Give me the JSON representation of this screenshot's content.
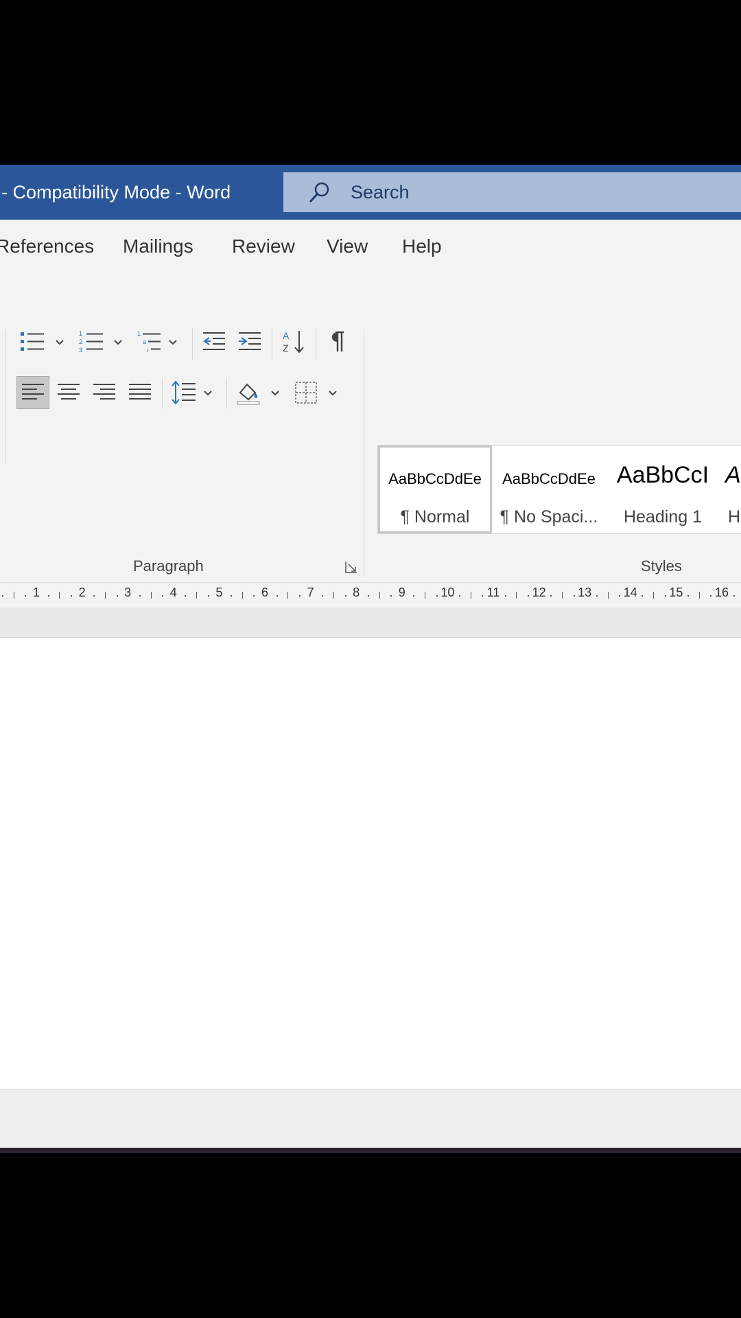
{
  "window": {
    "title": "- Compatibility Mode  -  Word"
  },
  "search": {
    "label": "Search"
  },
  "tabs": [
    {
      "label": "References"
    },
    {
      "label": "Mailings"
    },
    {
      "label": "Review"
    },
    {
      "label": "View"
    },
    {
      "label": "Help"
    }
  ],
  "ribbon": {
    "groups": {
      "paragraph": "Paragraph",
      "styles": "Styles"
    },
    "styles": [
      {
        "preview": "AaBbCcDdEe",
        "name": "¶ Normal"
      },
      {
        "preview": "AaBbCcDdEe",
        "name": "¶ No Spaci..."
      },
      {
        "preview": "AaBbCcI",
        "name": "Heading 1"
      },
      {
        "preview": "A",
        "name": "H"
      }
    ]
  },
  "ruler": {
    "numbers": [
      "1",
      "2",
      "3",
      "4",
      "5",
      "6",
      "7",
      "8",
      "9",
      "10",
      "11",
      "12",
      "13",
      "14",
      "15",
      "16"
    ]
  },
  "colors": {
    "titlebar": "#2b579a",
    "search_bg": "#a9bcd8",
    "accent_blue": "#2e75b6"
  }
}
